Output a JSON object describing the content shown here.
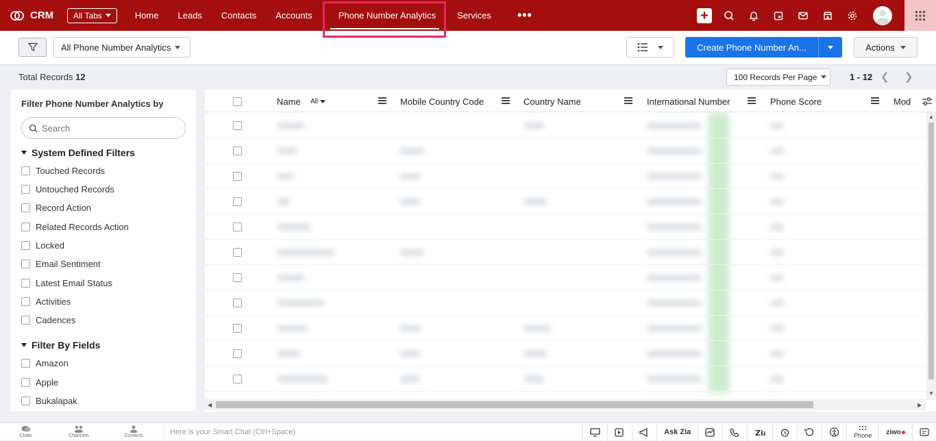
{
  "app": {
    "brand": "CRM"
  },
  "topnav": {
    "all_tabs": "All Tabs",
    "tabs": [
      {
        "label": "Home"
      },
      {
        "label": "Leads"
      },
      {
        "label": "Contacts"
      },
      {
        "label": "Accounts"
      },
      {
        "label": "Phone Number Analytics",
        "active": true
      },
      {
        "label": "Services"
      }
    ],
    "more": "•••"
  },
  "toolbar": {
    "view_selector": "All Phone Number Analytics",
    "create_button": "Create Phone Number An...",
    "actions_button": "Actions"
  },
  "records": {
    "total_label": "Total Records",
    "total_count": "12",
    "per_page": "100 Records Per Page",
    "range": "1 - 12"
  },
  "sidebar": {
    "title": "Filter Phone Number Analytics by",
    "search_placeholder": "Search",
    "sections": [
      {
        "title": "System Defined Filters",
        "items": [
          "Touched Records",
          "Untouched Records",
          "Record Action",
          "Related Records Action",
          "Locked",
          "Email Sentiment",
          "Latest Email Status",
          "Activities",
          "Cadences"
        ]
      },
      {
        "title": "Filter By Fields",
        "items": [
          "Amazon",
          "Apple",
          "Bukalapak"
        ]
      }
    ]
  },
  "table": {
    "name_filter": "All",
    "columns": [
      "Name",
      "Mobile Country Code",
      "Country Name",
      "International Number",
      "Phone Score",
      "Mod"
    ],
    "row_count": 12
  },
  "bottombar": {
    "items": [
      "Chats",
      "Channels",
      "Contacts"
    ],
    "smart_chat_placeholder": "Here is your Smart Chat (Ctrl+Space)",
    "ask_zia": "Ask Zia",
    "phone": "Phone",
    "ziwo": "ziwo"
  },
  "colors": {
    "topbar": "#a50e0e",
    "primary": "#1a73e8",
    "highlight": "#e8265e"
  }
}
